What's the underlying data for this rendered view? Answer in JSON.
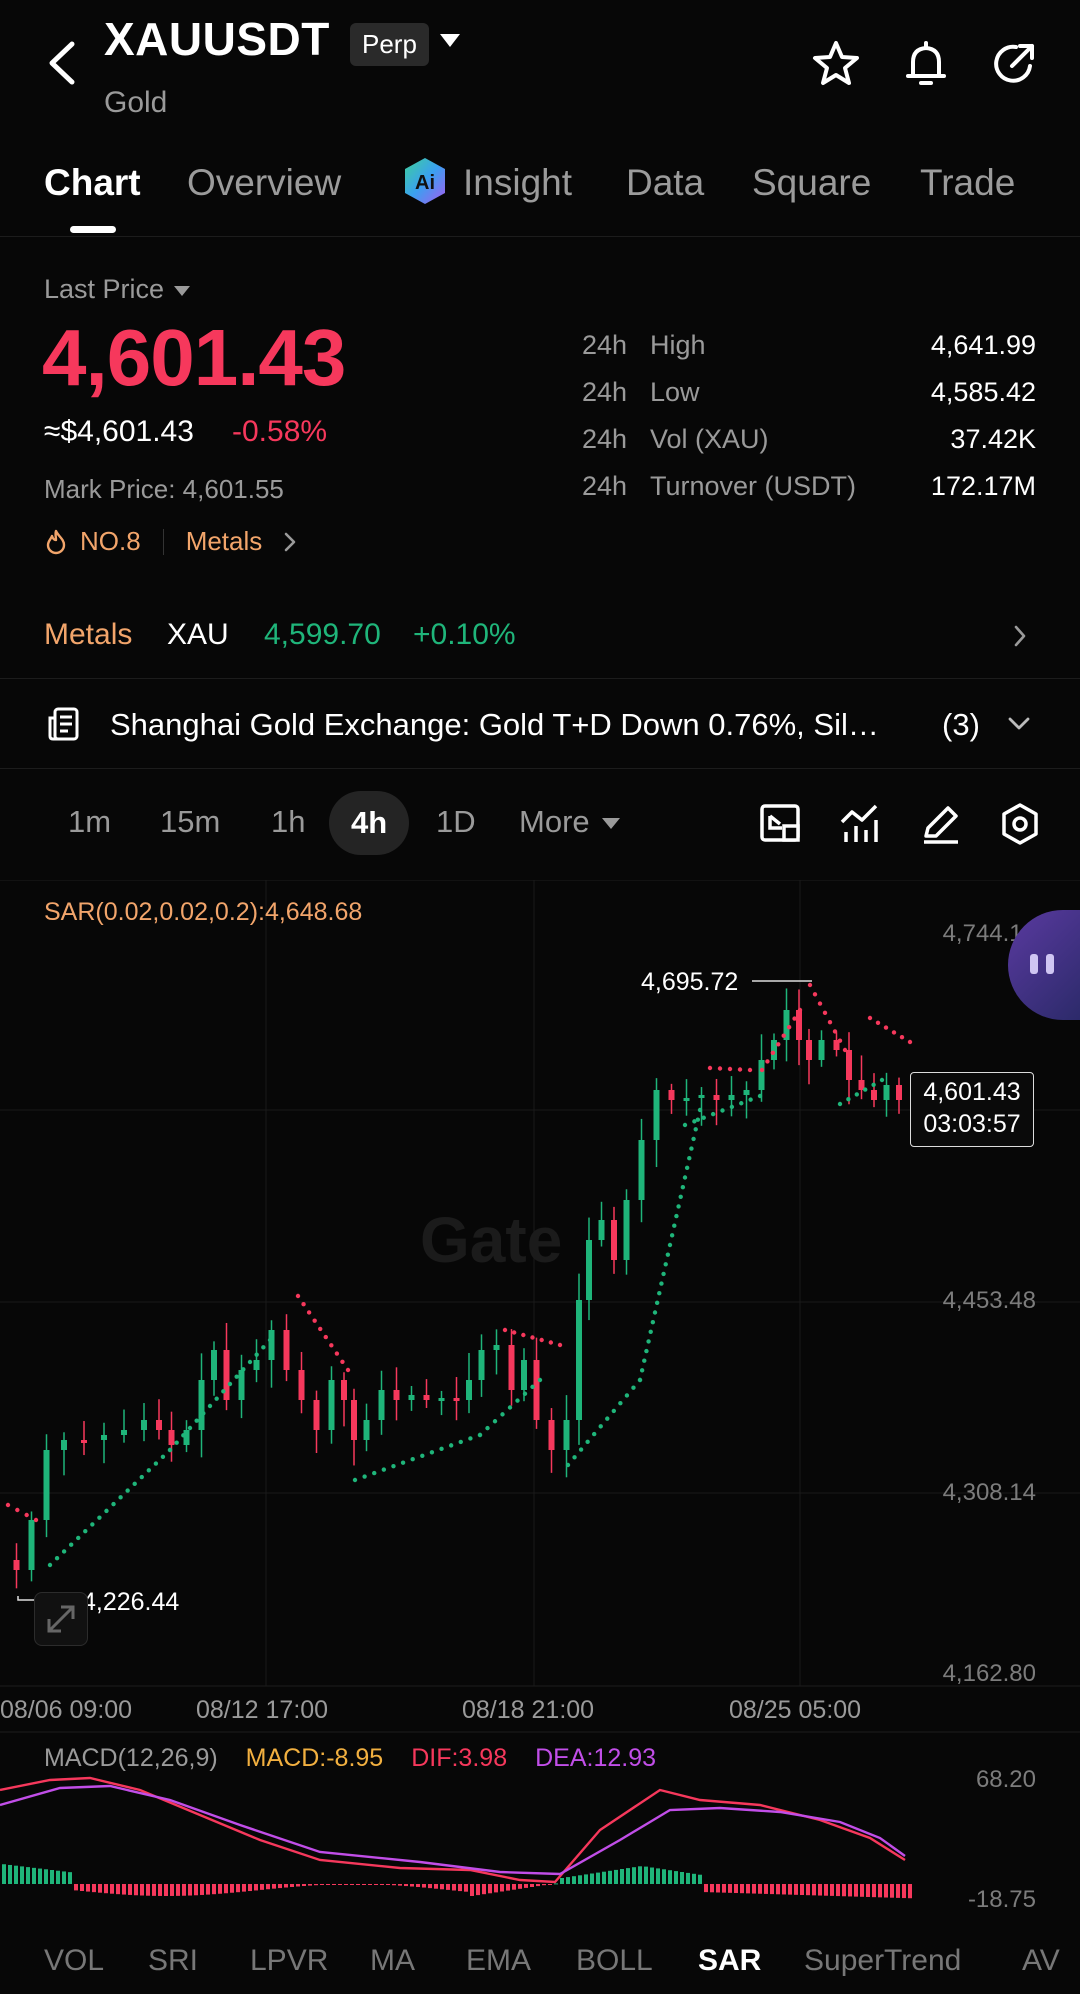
{
  "header": {
    "symbol": "XAUUSDT",
    "contract_type": "Perp",
    "subtitle": "Gold"
  },
  "tabs": [
    {
      "label": "Chart",
      "active": true
    },
    {
      "label": "Overview"
    },
    {
      "label": "Insight"
    },
    {
      "label": "Data"
    },
    {
      "label": "Square"
    },
    {
      "label": "Trade"
    }
  ],
  "price": {
    "label": "Last Price",
    "last": "4,601.43",
    "usd": "≈$4,601.43",
    "change": "-0.58%",
    "mark": "Mark Price: 4,601.55",
    "rank": "NO.8",
    "category": "Metals"
  },
  "stats": [
    {
      "period": "24h",
      "label": "High",
      "value": "4,641.99"
    },
    {
      "period": "24h",
      "label": "Low",
      "value": "4,585.42"
    },
    {
      "period": "24h",
      "label": "Vol (XAU)",
      "value": "37.42K"
    },
    {
      "period": "24h",
      "label": "Turnover (USDT)",
      "value": "172.17M"
    }
  ],
  "metals": {
    "label": "Metals",
    "symbol": "XAU",
    "price": "4,599.70",
    "change": "+0.10%"
  },
  "news": {
    "text": "Shanghai Gold Exchange: Gold T+D Down 0.76%, Sil…",
    "count": "(3)"
  },
  "intervals": [
    "1m",
    "15m",
    "1h",
    "4h",
    "1D",
    "More"
  ],
  "active_interval": "4h",
  "chart": {
    "sar_label": "SAR(0.02,0.02,0.2):4,648.68",
    "price_axis": [
      "4,744.16",
      "4,453.48",
      "4,308.14",
      "4,162.80"
    ],
    "time_axis": [
      "08/06 09:00",
      "08/12 17:00",
      "08/18 21:00",
      "08/25 05:00"
    ],
    "high_marker": "4,695.72",
    "low_marker": "4,226.44",
    "current_price": "4,601.43",
    "countdown": "03:03:57",
    "watermark": "Gate"
  },
  "chart_data": {
    "type": "candlestick",
    "ylim": [
      4162.8,
      4744.16
    ],
    "series_description": "4h candles with SAR dots",
    "macd": {
      "label": "MACD(12,26,9)",
      "macd": "MACD:-8.95",
      "dif": "DIF:3.98",
      "dea": "DEA:12.93",
      "axis": [
        "68.20",
        "-18.75"
      ]
    }
  },
  "indicator_tabs": [
    "VOL",
    "SRI",
    "LPVR",
    "MA",
    "EMA",
    "BOLL",
    "SAR",
    "SuperTrend",
    "AV"
  ],
  "active_indicator": "SAR",
  "colors": {
    "up": "#1fb57a",
    "down": "#f6385c",
    "accent_orange": "#f2a56b"
  }
}
